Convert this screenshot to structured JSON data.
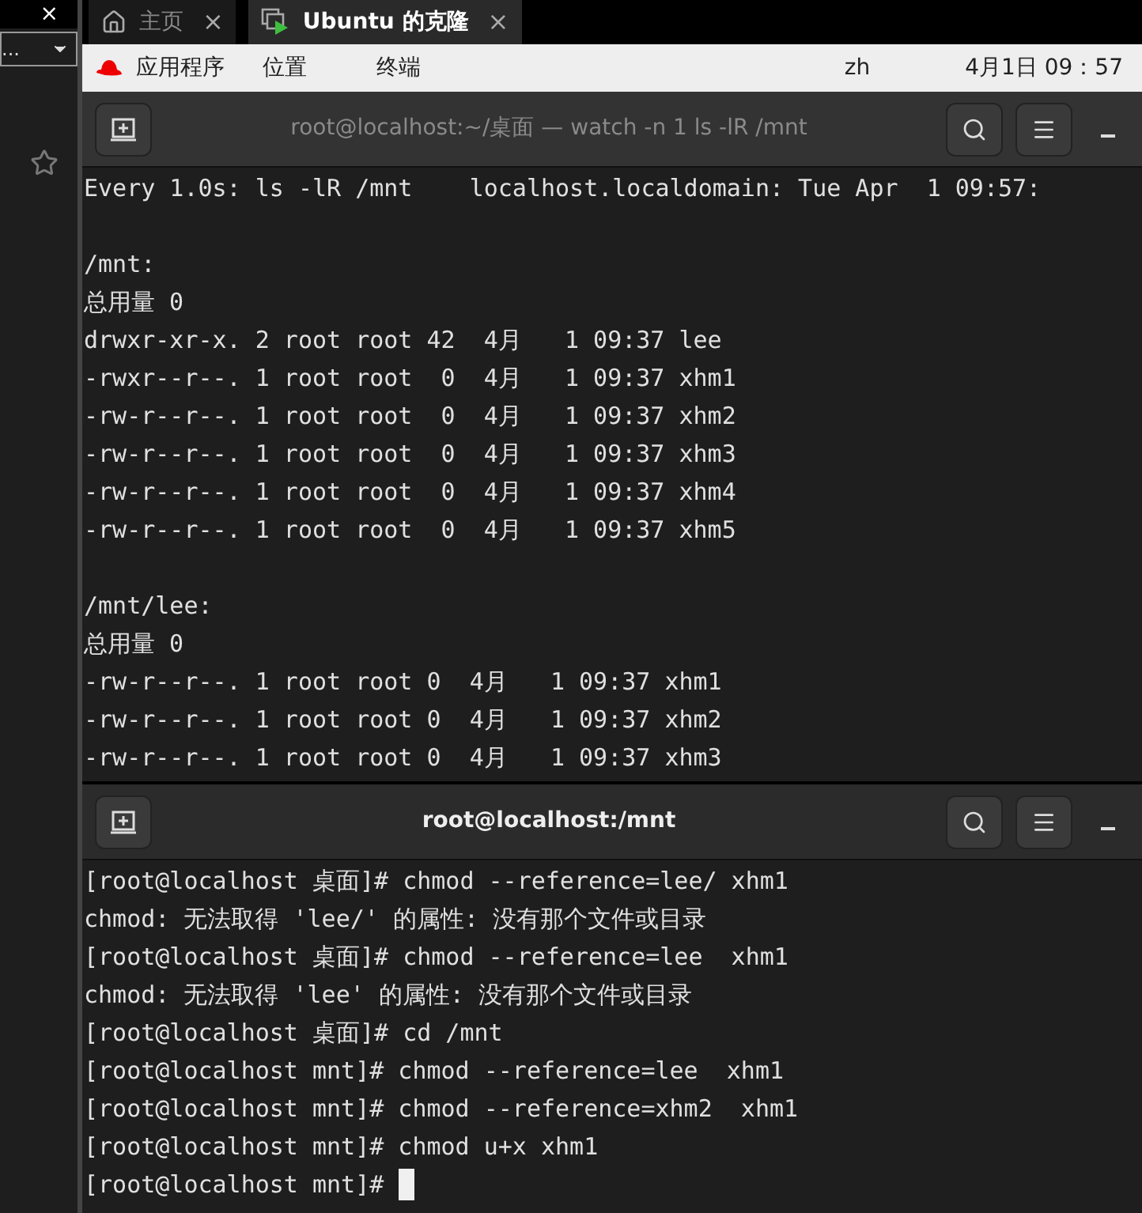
{
  "sidebar": {
    "close": "×",
    "dropdown": {
      "value": "..."
    }
  },
  "tabs": [
    {
      "label": "主页",
      "kind": "home",
      "close": "×",
      "selected": false
    },
    {
      "label": "Ubuntu 的克隆",
      "kind": "vm",
      "close": "×",
      "selected": true
    }
  ],
  "top_bar": {
    "menus": [
      "应用程序",
      "位置",
      "终端"
    ],
    "input_method": "zh",
    "clock": "4月1日 09：57"
  },
  "terminals": [
    {
      "title": "root@localhost:~/桌面 — watch -n 1 ls -lR /mnt",
      "focused": false,
      "sections": [
        {
          "lines": [
            "Every 1.0s: ls -lR /mnt    localhost.localdomain: Tue Apr  1 09:57:"
          ]
        },
        {
          "lines": [
            "/mnt:",
            "总用量 0",
            "drwxr-xr-x. 2 root root 42  4月   1 09:37 lee",
            "-rwxr--r--. 1 root root  0  4月   1 09:37 xhm1",
            "-rw-r--r--. 1 root root  0  4月   1 09:37 xhm2",
            "-rw-r--r--. 1 root root  0  4月   1 09:37 xhm3",
            "-rw-r--r--. 1 root root  0  4月   1 09:37 xhm4",
            "-rw-r--r--. 1 root root  0  4月   1 09:37 xhm5"
          ]
        },
        {
          "lines": [
            "/mnt/lee:",
            "总用量 0",
            "-rw-r--r--. 1 root root 0  4月   1 09:37 xhm1",
            "-rw-r--r--. 1 root root 0  4月   1 09:37 xhm2",
            "-rw-r--r--. 1 root root 0  4月   1 09:37 xhm3"
          ]
        }
      ]
    },
    {
      "title": "root@localhost:/mnt",
      "focused": true,
      "cursor": true,
      "sections": [
        {
          "lines": [
            "[root@localhost 桌面]# chmod --reference=lee/ xhm1",
            "chmod: 无法取得 'lee/' 的属性: 没有那个文件或目录",
            "[root@localhost 桌面]# chmod --reference=lee  xhm1",
            "chmod: 无法取得 'lee' 的属性: 没有那个文件或目录",
            "[root@localhost 桌面]# cd /mnt",
            "[root@localhost mnt]# chmod --reference=lee  xhm1",
            "[root@localhost mnt]# chmod --reference=xhm2  xhm1",
            "[root@localhost mnt]# chmod u+x xhm1",
            "[root@localhost mnt]# "
          ]
        }
      ]
    }
  ]
}
